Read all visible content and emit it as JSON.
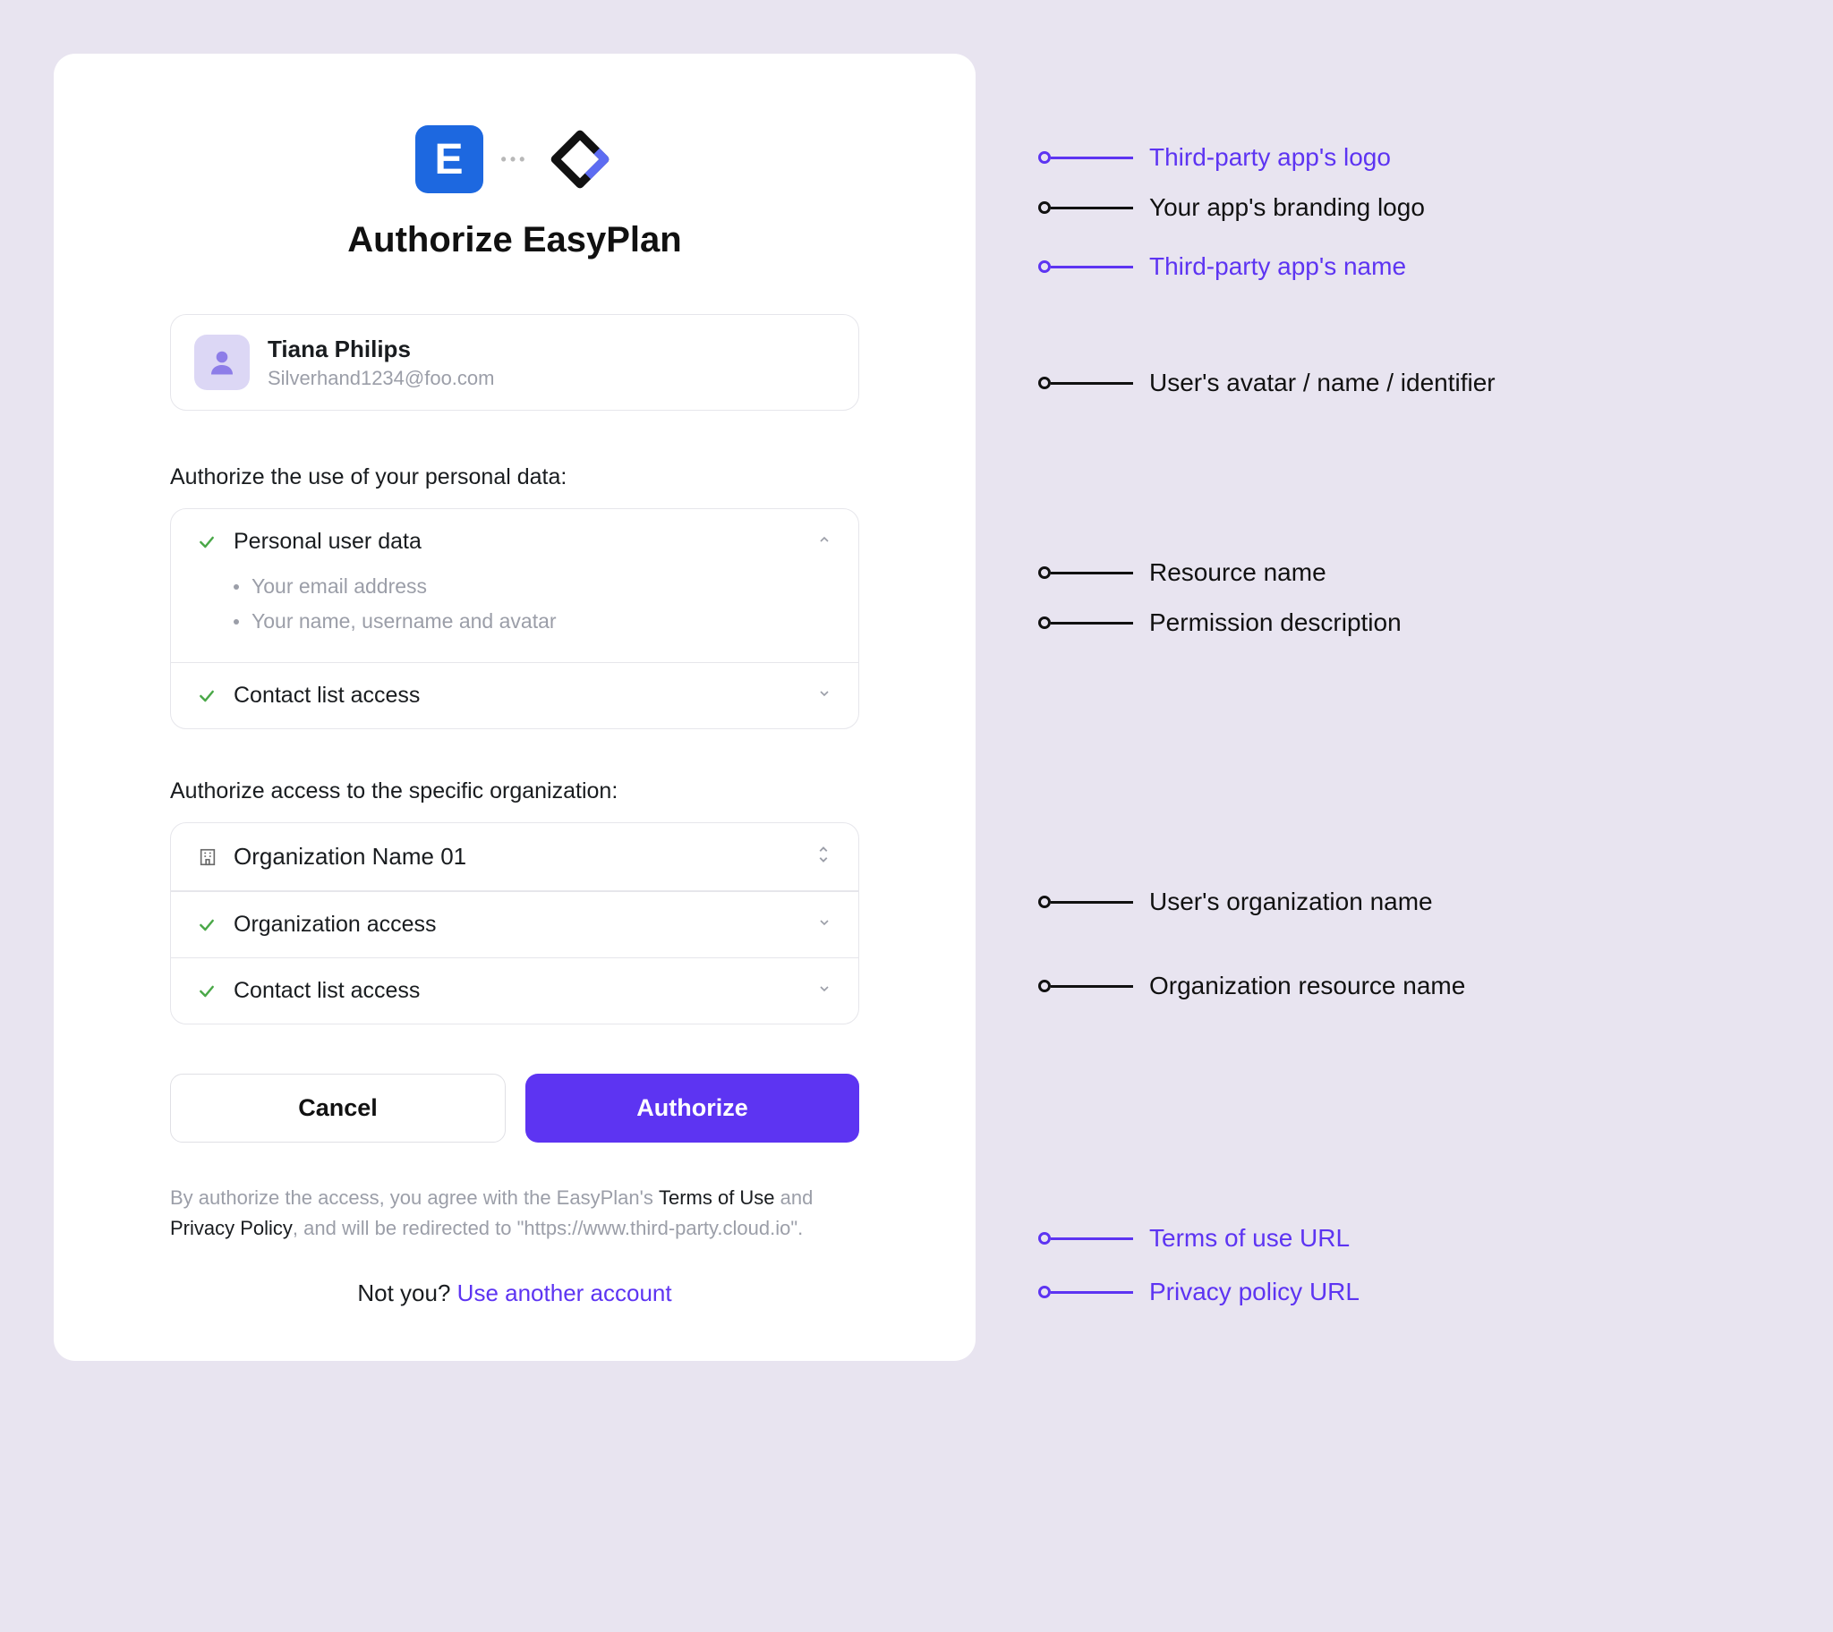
{
  "title": "Authorize EasyPlan",
  "third_party_logo_letter": "E",
  "user": {
    "name": "Tiana Philips",
    "email": "Silverhand1234@foo.com"
  },
  "section_personal_label": "Authorize the use of your personal data:",
  "permissions": {
    "personal_data": {
      "name": "Personal user data",
      "details": [
        "Your email address",
        "Your name, username and avatar"
      ]
    },
    "contact_access": {
      "name": "Contact list access"
    }
  },
  "section_org_label": "Authorize access to the specific organization:",
  "organization": {
    "name": "Organization Name 01"
  },
  "org_permissions": [
    {
      "name": "Organization access"
    },
    {
      "name": "Contact list access"
    }
  ],
  "buttons": {
    "cancel": "Cancel",
    "authorize": "Authorize"
  },
  "footer": {
    "pre": "By authorize the access, you agree with the EasyPlan's ",
    "terms": "Terms of Use",
    "mid": " and ",
    "privacy": "Privacy Policy",
    "post": ", and will be redirected to \"https://www.third-party.cloud.io\"."
  },
  "switch": {
    "prompt": "Not you? ",
    "link": "Use another account"
  },
  "annotations": {
    "third_party_logo": "Third-party app's logo",
    "your_logo": "Your app's branding logo",
    "third_party_name": "Third-party app's name",
    "user_info": "User's avatar / name / identifier",
    "resource_name": "Resource name",
    "permission_desc": "Permission description",
    "org_name": "User's organization name",
    "org_resource_name": "Organization resource name",
    "terms_url": "Terms of use URL",
    "privacy_url": "Privacy policy URL"
  }
}
